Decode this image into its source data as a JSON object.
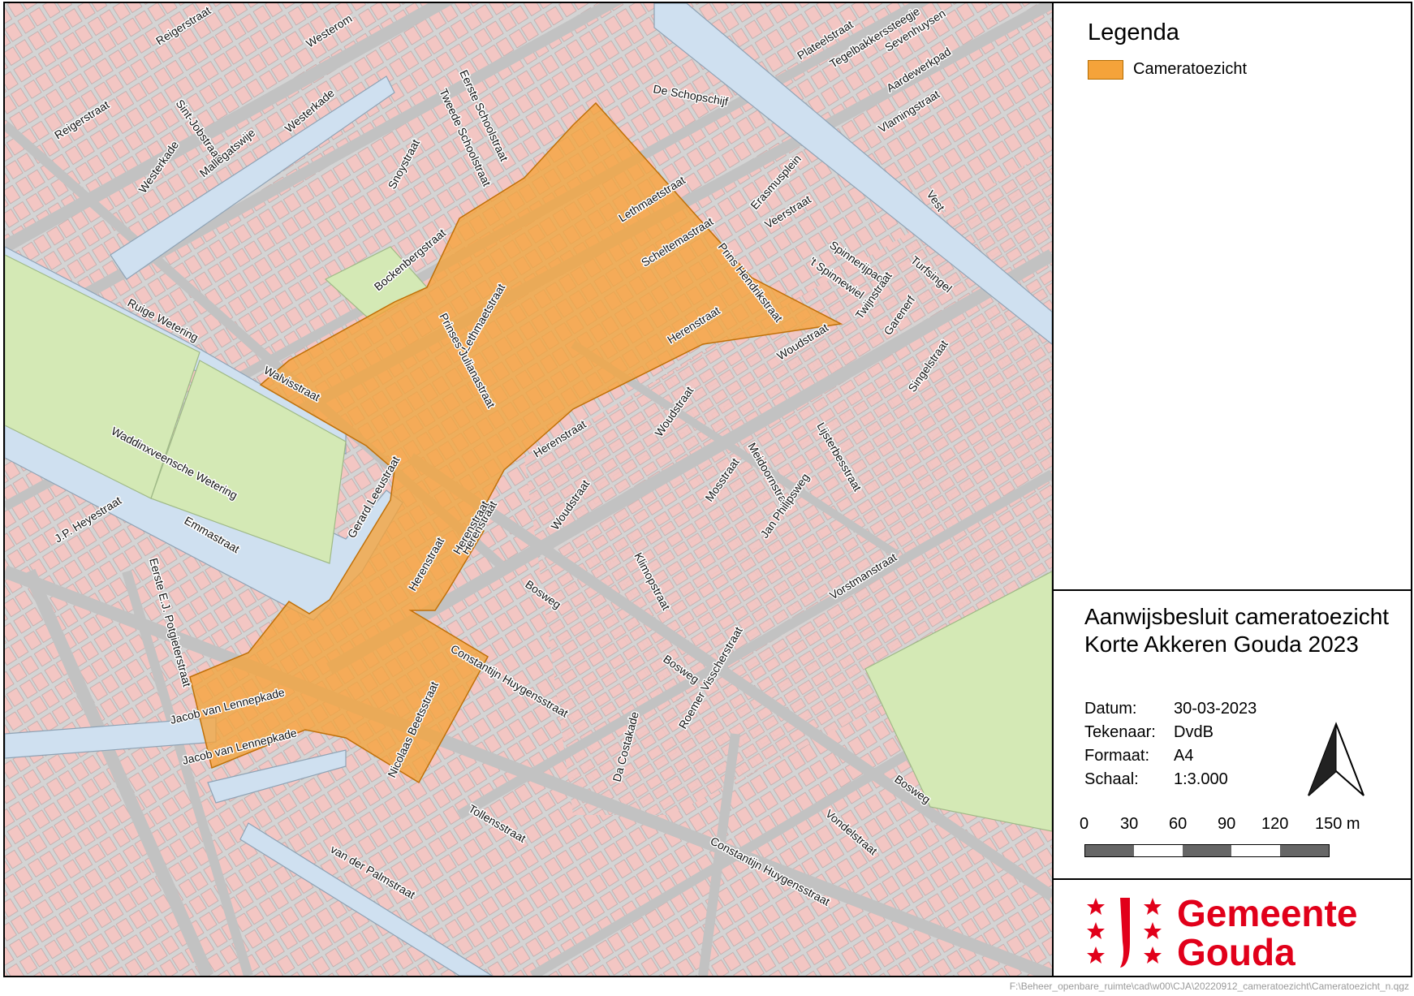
{
  "legend": {
    "title": "Legenda",
    "items": [
      {
        "label": "Cameratoezicht",
        "color": "#f5a33a"
      }
    ]
  },
  "info": {
    "title_line1": "Aanwijsbesluit cameratoezicht",
    "title_line2": "Korte Akkeren Gouda 2023",
    "rows": [
      {
        "key": "Datum:",
        "value": "30-03-2023"
      },
      {
        "key": "Tekenaar:",
        "value": "DvdB"
      },
      {
        "key": "Formaat:",
        "value": "A4"
      },
      {
        "key": "Schaal:",
        "value": "1:3.000"
      }
    ],
    "scale_ticks": [
      "0",
      "30",
      "60",
      "90",
      "120",
      "150 m"
    ]
  },
  "logo": {
    "line1": "Gemeente",
    "line2": "Gouda",
    "color": "#e1001a"
  },
  "footer": {
    "file_path": "F:\\Beheer_openbare_ruimte\\cad\\w00\\CJA\\20220912_cameratoezicht\\Cameratoezicht_n.qgz"
  },
  "map": {
    "colors": {
      "building": "#f3c6c3",
      "road": "#cfcfcf",
      "water": "#cfe0f0",
      "park": "#d4e9b5",
      "zone": "#f5a33a"
    },
    "street_labels": [
      "Reigerstraat",
      "Westerom",
      "Reigerstraat",
      "Sint-Jobstraat",
      "Mallegatswije",
      "Westerkade",
      "Westerkade",
      "Eerste Schoolstraat",
      "Tweede Schoolstraat",
      "Snoystraat",
      "De Schopschijf",
      "Plateelstraat",
      "Tegelbakkerssteegje",
      "Sevenhuysen",
      "Aardewerkpad",
      "Vlamingstraat",
      "Vest",
      "Lethmaetstraat",
      "Erasmusplein",
      "Veerstraat",
      "Scheltemastraat",
      "Prins Hendrikstraat",
      "Spinnerijpad",
      "'t Spinnewiel",
      "Turfsingel",
      "Twijnstraat",
      "Garenerf",
      "Bockenbergstraat",
      "Lethmaetstraat",
      "Prinses Julianastraat",
      "Herenstraat",
      "Woudstraat",
      "Singelstraat",
      "Ruige Wetering",
      "Walvisstraat",
      "Herenstraat",
      "Woudstraat",
      "Lijsterbesstraat",
      "Meidoornstraat",
      "Mosstraat",
      "Jan Philipsweg",
      "Waddinxveensche Wetering",
      "Gerard Leeustraat",
      "Woudstraat",
      "Herenstraat",
      "J.P. Heyestraat",
      "Emmastraat",
      "Herenstraat",
      "Eerste E.J. Potgieterstraat",
      "Herenstraat",
      "Bosweg",
      "Klimopstraat",
      "Vorstmanstraat",
      "Constantijn Huygensstraat",
      "Jacob van Lennepkade",
      "Jacob van Lennepkade",
      "Nicolaas Beetsstraat",
      "Bosweg",
      "Roemer Visscherstraat",
      "Da Costakade",
      "Tollensstraat",
      "van der Palmstraat",
      "Constantijn Huygensstraat",
      "Vondelstraat",
      "Bosweg"
    ]
  }
}
